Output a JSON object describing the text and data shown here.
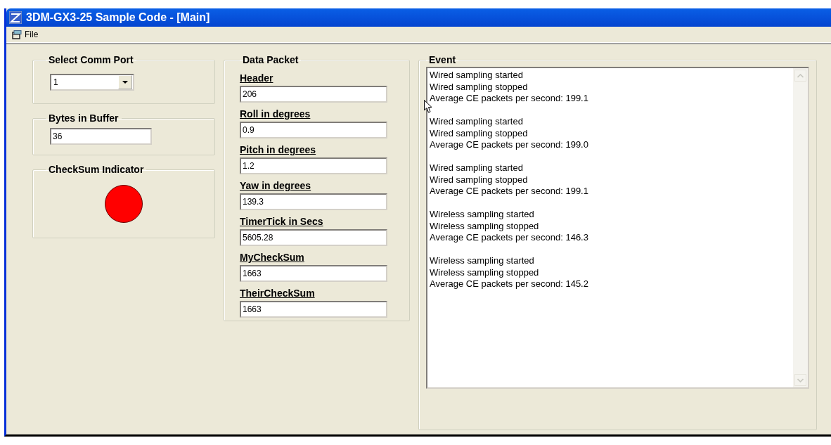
{
  "window": {
    "title": "3DM-GX3-25 Sample Code - [Main]"
  },
  "menu": [
    {
      "label": "File"
    }
  ],
  "comm_port": {
    "title": "Select Comm Port",
    "value": "1"
  },
  "bytes_in_buffer": {
    "title": "Bytes in Buffer",
    "value": "36"
  },
  "checksum_indicator": {
    "title": "CheckSum Indicator",
    "color": "#ff0000"
  },
  "data_packet": {
    "title": "Data Packet",
    "fields": [
      {
        "label": "Header",
        "value": "206"
      },
      {
        "label": "Roll in degrees",
        "value": "0.9"
      },
      {
        "label": "Pitch in degrees",
        "value": "1.2"
      },
      {
        "label": "Yaw in degrees",
        "value": "139.3"
      },
      {
        "label": "TimerTick in Secs",
        "value": "5605.28"
      },
      {
        "label": "MyCheckSum",
        "value": "1663"
      },
      {
        "label": "TheirCheckSum",
        "value": "1663"
      }
    ]
  },
  "event": {
    "title": "Event",
    "groups": [
      {
        "lines": [
          "Wired sampling started",
          "Wired sampling stopped",
          "Average CE packets per second: 199.1"
        ]
      },
      {
        "lines": [
          "Wired sampling started",
          "Wired sampling stopped",
          "Average CE packets per second: 199.0"
        ]
      },
      {
        "lines": [
          "Wired sampling started",
          "Wired sampling stopped",
          "Average CE packets per second: 199.1"
        ]
      },
      {
        "lines": [
          "Wireless sampling started",
          "Wireless sampling stopped",
          "Average CE packets per second: 146.3"
        ]
      },
      {
        "lines": [
          "Wireless sampling started",
          "Wireless sampling stopped",
          "Average CE packets per second: 145.2"
        ]
      }
    ]
  }
}
